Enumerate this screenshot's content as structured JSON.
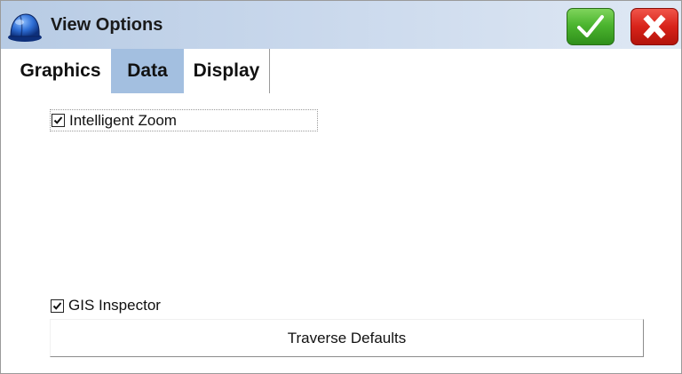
{
  "window": {
    "title": "View Options",
    "icon": "hard-hat-icon",
    "ok_icon": "checkmark-icon",
    "cancel_icon": "x-icon"
  },
  "tabs": [
    {
      "label": "Graphics",
      "active": false
    },
    {
      "label": "Data",
      "active": true
    },
    {
      "label": "Display",
      "active": false
    }
  ],
  "options": {
    "intelligent_zoom": {
      "label": "Intelligent Zoom",
      "checked": true
    },
    "gis_inspector": {
      "label": "GIS Inspector",
      "checked": true
    }
  },
  "buttons": {
    "traverse_defaults": "Traverse Defaults"
  },
  "colors": {
    "active_tab": "#a3bfe0",
    "ok_green": "#4cb52f",
    "cancel_red": "#d8231a"
  }
}
